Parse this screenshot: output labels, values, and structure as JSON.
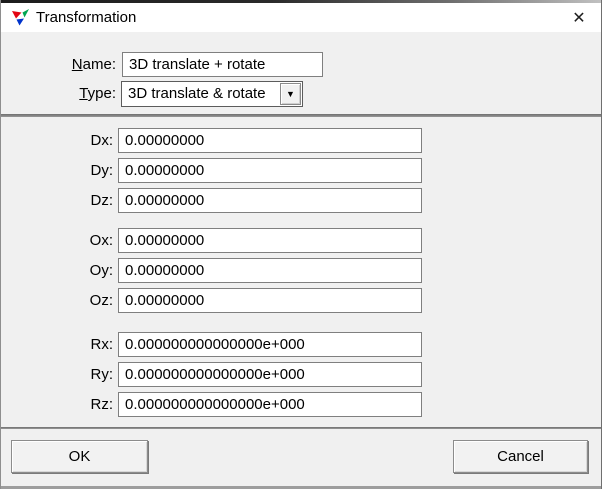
{
  "window": {
    "title": "Transformation",
    "close_glyph": "✕"
  },
  "header": {
    "name_label": {
      "mnemonic": "N",
      "rest": "ame:"
    },
    "name_value": "3D translate + rotate",
    "type_label": {
      "mnemonic": "T",
      "rest": "ype:"
    },
    "type_value": "3D translate & rotate",
    "dropdown_glyph": "▼"
  },
  "rows": [
    {
      "label": "Dx:",
      "value": "0.00000000"
    },
    {
      "label": "Dy:",
      "value": "0.00000000"
    },
    {
      "label": "Dz:",
      "value": "0.00000000"
    },
    {
      "label": "Ox:",
      "value": "0.00000000"
    },
    {
      "label": "Oy:",
      "value": "0.00000000"
    },
    {
      "label": "Oz:",
      "value": "0.00000000"
    },
    {
      "label": "Rx:",
      "value": "0.000000000000000e+000"
    },
    {
      "label": "Ry:",
      "value": "0.000000000000000e+000"
    },
    {
      "label": "Rz:",
      "value": "0.000000000000000e+000"
    }
  ],
  "buttons": {
    "ok": "OK",
    "cancel": "Cancel"
  },
  "colors": {
    "dialog_bg": "#f0f0f0",
    "titlebar_bg": "#ffffff",
    "divider": "#7d7d7d",
    "input_border": "#7f7f7f",
    "icon_red": "#e30613",
    "icon_green": "#00a651",
    "icon_blue": "#0033cc"
  }
}
